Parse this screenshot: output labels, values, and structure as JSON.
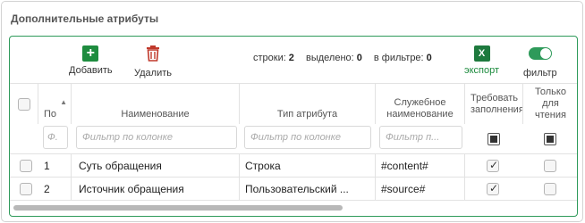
{
  "panel": {
    "title": "Дополнительные атрибуты"
  },
  "toolbar": {
    "add_label": "Добавить",
    "delete_label": "Удалить",
    "export_label": "экспорт",
    "filter_label": "фильтр",
    "rows_label": "строки:",
    "rows_value": "2",
    "selected_label": "выделено:",
    "selected_value": "0",
    "in_filter_label": "в фильтре:",
    "in_filter_value": "0",
    "filter_toggle_on": true
  },
  "grid": {
    "columns": [
      {
        "label": ""
      },
      {
        "label": "По"
      },
      {
        "label": "Наименование"
      },
      {
        "label": "Тип атрибута"
      },
      {
        "label": "Служебное наименование"
      },
      {
        "label": "Требовать заполнения"
      },
      {
        "label": "Только для чтения"
      }
    ],
    "filter_placeholders": {
      "order": "Ф.",
      "name": "Фильтр по колонке",
      "type": "Фильтр по колонке",
      "service": "Фильтр п..."
    },
    "rows": [
      {
        "order": "1",
        "name": "Суть обращения",
        "type": "Строка",
        "service": "#content#",
        "required": true,
        "readonly": false
      },
      {
        "order": "2",
        "name": "Источник обращения",
        "type": "Пользовательский ...",
        "service": "#source#",
        "required": true,
        "readonly": false
      }
    ]
  },
  "colors": {
    "accent": "#2e9a5a",
    "add": "#1e8c3f",
    "delete": "#c0392b",
    "excel": "#1e7a3e"
  }
}
